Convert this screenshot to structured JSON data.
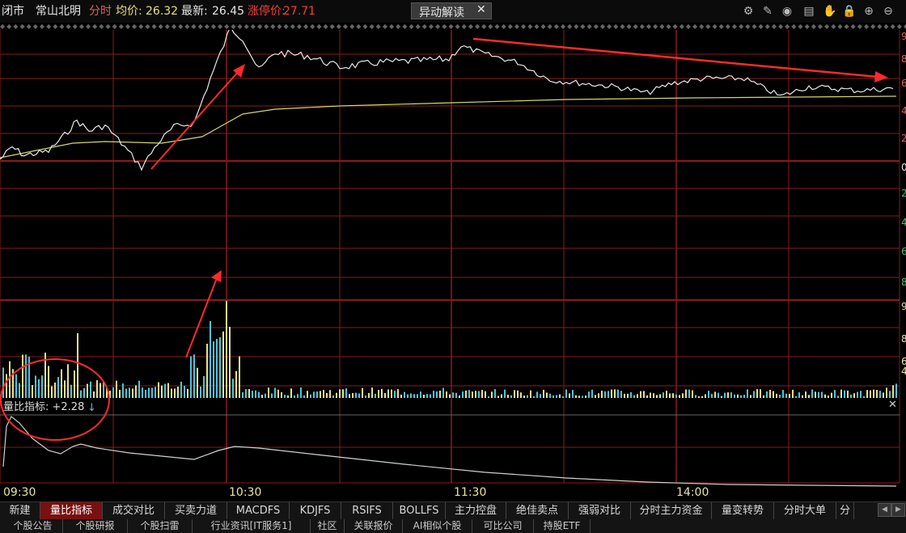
{
  "header": {
    "status": "闭市",
    "stock_name": "常山北明",
    "mode": "分时",
    "avg_label": "均价:",
    "avg_value": "26.32",
    "latest_label": "最新:",
    "latest_value": "26.45",
    "limit_label": "涨停价:",
    "limit_value": "27.71",
    "anomaly_button": "异动解读",
    "close_glyph": "✕"
  },
  "toolbar_icons": [
    "gear-icon",
    "pen-icon",
    "eye-icon",
    "stack-icon",
    "hand-icon",
    "lock-icon",
    "zoom-in-icon",
    "zoom-out-icon"
  ],
  "indicator": {
    "label": "量比指标: +2.28",
    "arrow": "↓"
  },
  "time_axis": [
    "09:30",
    "10:30",
    "11:30",
    "14:00"
  ],
  "right_axis_partial": [
    "9",
    "8",
    "6",
    "4",
    "2",
    "0",
    "2",
    "4",
    "6",
    "8",
    "9",
    "8",
    "6",
    "4"
  ],
  "tabs": [
    {
      "label": "新建"
    },
    {
      "label": "量比指标",
      "active": true
    },
    {
      "label": "成交对比"
    },
    {
      "label": "买卖力道"
    },
    {
      "label": "MACDFS"
    },
    {
      "label": "KDJFS"
    },
    {
      "label": "RSIFS"
    },
    {
      "label": "BOLLFS"
    },
    {
      "label": "主力控盘"
    },
    {
      "label": "绝佳卖点"
    },
    {
      "label": "强弱对比"
    },
    {
      "label": "分时主力资金"
    },
    {
      "label": "量变转势"
    },
    {
      "label": "分时大单"
    },
    {
      "label": "分"
    }
  ],
  "tabs_secondary": [
    "个股公告",
    "个股研报",
    "个股扫雷",
    "行业资讯[IT服务1]",
    "社区",
    "关联报价",
    "AI相似个股",
    "可比公司",
    "持股ETF"
  ],
  "colors": {
    "grid": "#8b1a1a",
    "price_line": "#e8e8e8",
    "avg_line": "#d6d66a",
    "vol_up": "#e8e08a",
    "vol_down": "#4fc3d9",
    "annotation": "#ff2a2a",
    "limit": "#ff3b3b",
    "mode": "#e06060",
    "avg": "#e8e070"
  }
}
